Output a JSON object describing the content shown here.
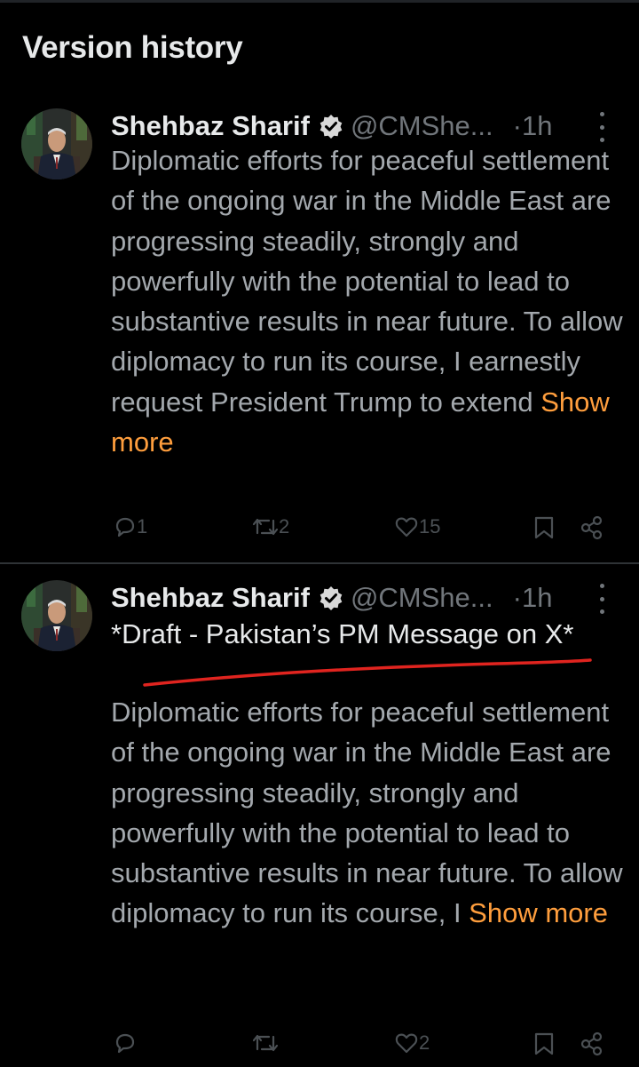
{
  "page": {
    "title": "Version history"
  },
  "posts": [
    {
      "author": "Shehbaz Sharif",
      "handle": "@CMShe...",
      "dot": "·",
      "time": "1h",
      "text": "Diplomatic efforts for peaceful settlement of the ongoing war in the Middle East are progressing steadily, strongly and powerfully with the potential to lead to substantive results in near future. To allow diplomacy to run its course, I earnestly request President Trump to extend ",
      "show_more": "Show more",
      "replies": "1",
      "reposts": "2",
      "likes": "15"
    },
    {
      "author": "Shehbaz Sharif",
      "handle": "@CMShe...",
      "dot": "·",
      "time": "1h",
      "subtitle": "*Draft - Pakistan’s PM Message on X*",
      "text": "Diplomatic efforts for peaceful settlement of the ongoing war in the Middle East are progressing steadily, strongly and powerfully with the potential to lead to substantive results in near future. To allow diplomacy to run its course, I ",
      "show_more": "Show more",
      "replies": "",
      "reposts": "",
      "likes": "2"
    }
  ],
  "colors": {
    "background": "#000000",
    "text_primary": "#e7e9ea",
    "text_secondary": "#a3a8ad",
    "muted": "#71767b",
    "link": "#ff9e3d",
    "annotation": "#e0241f"
  },
  "icons": [
    "verified-badge-icon",
    "more-options-icon",
    "reply-icon",
    "repost-icon",
    "like-icon",
    "bookmark-icon",
    "share-icon"
  ]
}
